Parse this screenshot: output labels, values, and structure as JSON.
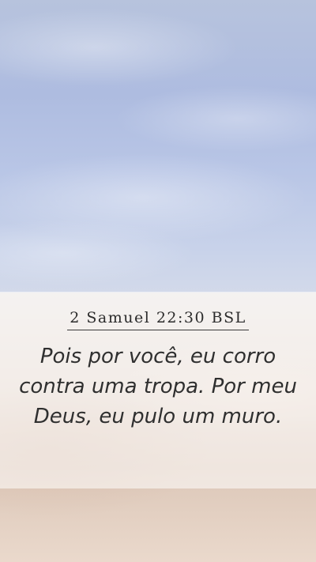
{
  "verse": {
    "reference": "2 Samuel 22:30 BSL",
    "text": "Pois por você, eu corro contra uma tropa. Por meu Deus, eu pulo um muro."
  }
}
